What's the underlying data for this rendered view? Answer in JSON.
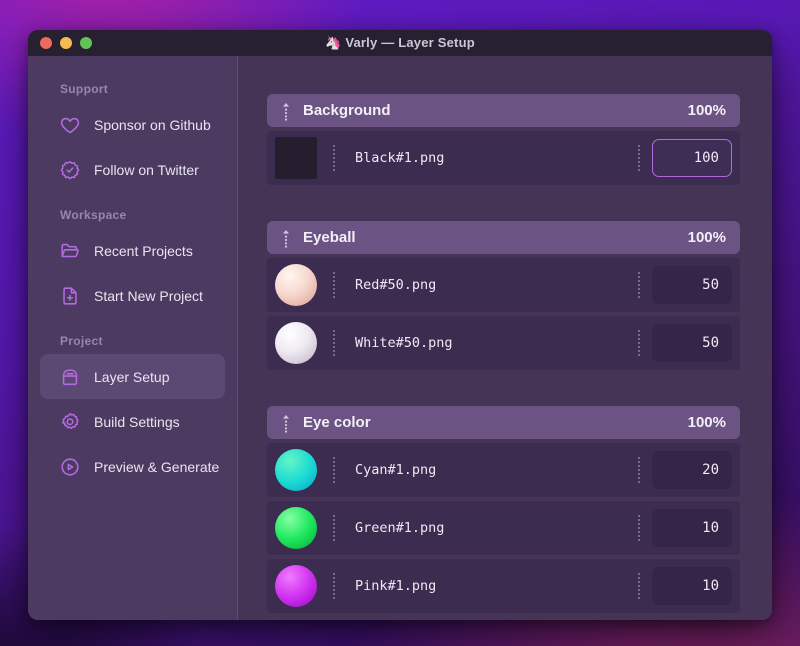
{
  "window": {
    "title": "Varly — Layer Setup",
    "title_icon": "🦄"
  },
  "colors": {
    "accent": "#b46ae2",
    "header_bg": "#6b5483",
    "row_bg": "#3c2c4f",
    "sidebar_bg": "#4c3a61",
    "main_bg": "#463457",
    "focus_border": "#b06ae0"
  },
  "sidebar": {
    "sections": [
      {
        "label": "Support",
        "items": [
          {
            "label": "Sponsor on Github"
          },
          {
            "label": "Follow on Twitter"
          }
        ]
      },
      {
        "label": "Workspace",
        "items": [
          {
            "label": "Recent Projects"
          },
          {
            "label": "Start New Project"
          }
        ]
      },
      {
        "label": "Project",
        "items": [
          {
            "label": "Layer Setup",
            "selected": true
          },
          {
            "label": "Build Settings"
          },
          {
            "label": "Preview & Generate"
          }
        ]
      }
    ]
  },
  "layers": {
    "groups": [
      {
        "name": "Background",
        "weight": "100%",
        "items": [
          {
            "file": "Black#1.png",
            "value": "100",
            "thumb": "black-square",
            "focused": true
          }
        ]
      },
      {
        "name": "Eyeball",
        "weight": "100%",
        "items": [
          {
            "file": "Red#50.png",
            "value": "50",
            "thumb": "red-sphere"
          },
          {
            "file": "White#50.png",
            "value": "50",
            "thumb": "white-sphere"
          }
        ]
      },
      {
        "name": "Eye color",
        "weight": "100%",
        "items": [
          {
            "file": "Cyan#1.png",
            "value": "20",
            "thumb": "cyan-sphere"
          },
          {
            "file": "Green#1.png",
            "value": "10",
            "thumb": "green-sphere"
          },
          {
            "file": "Pink#1.png",
            "value": "10",
            "thumb": "pink-sphere"
          }
        ]
      }
    ]
  }
}
